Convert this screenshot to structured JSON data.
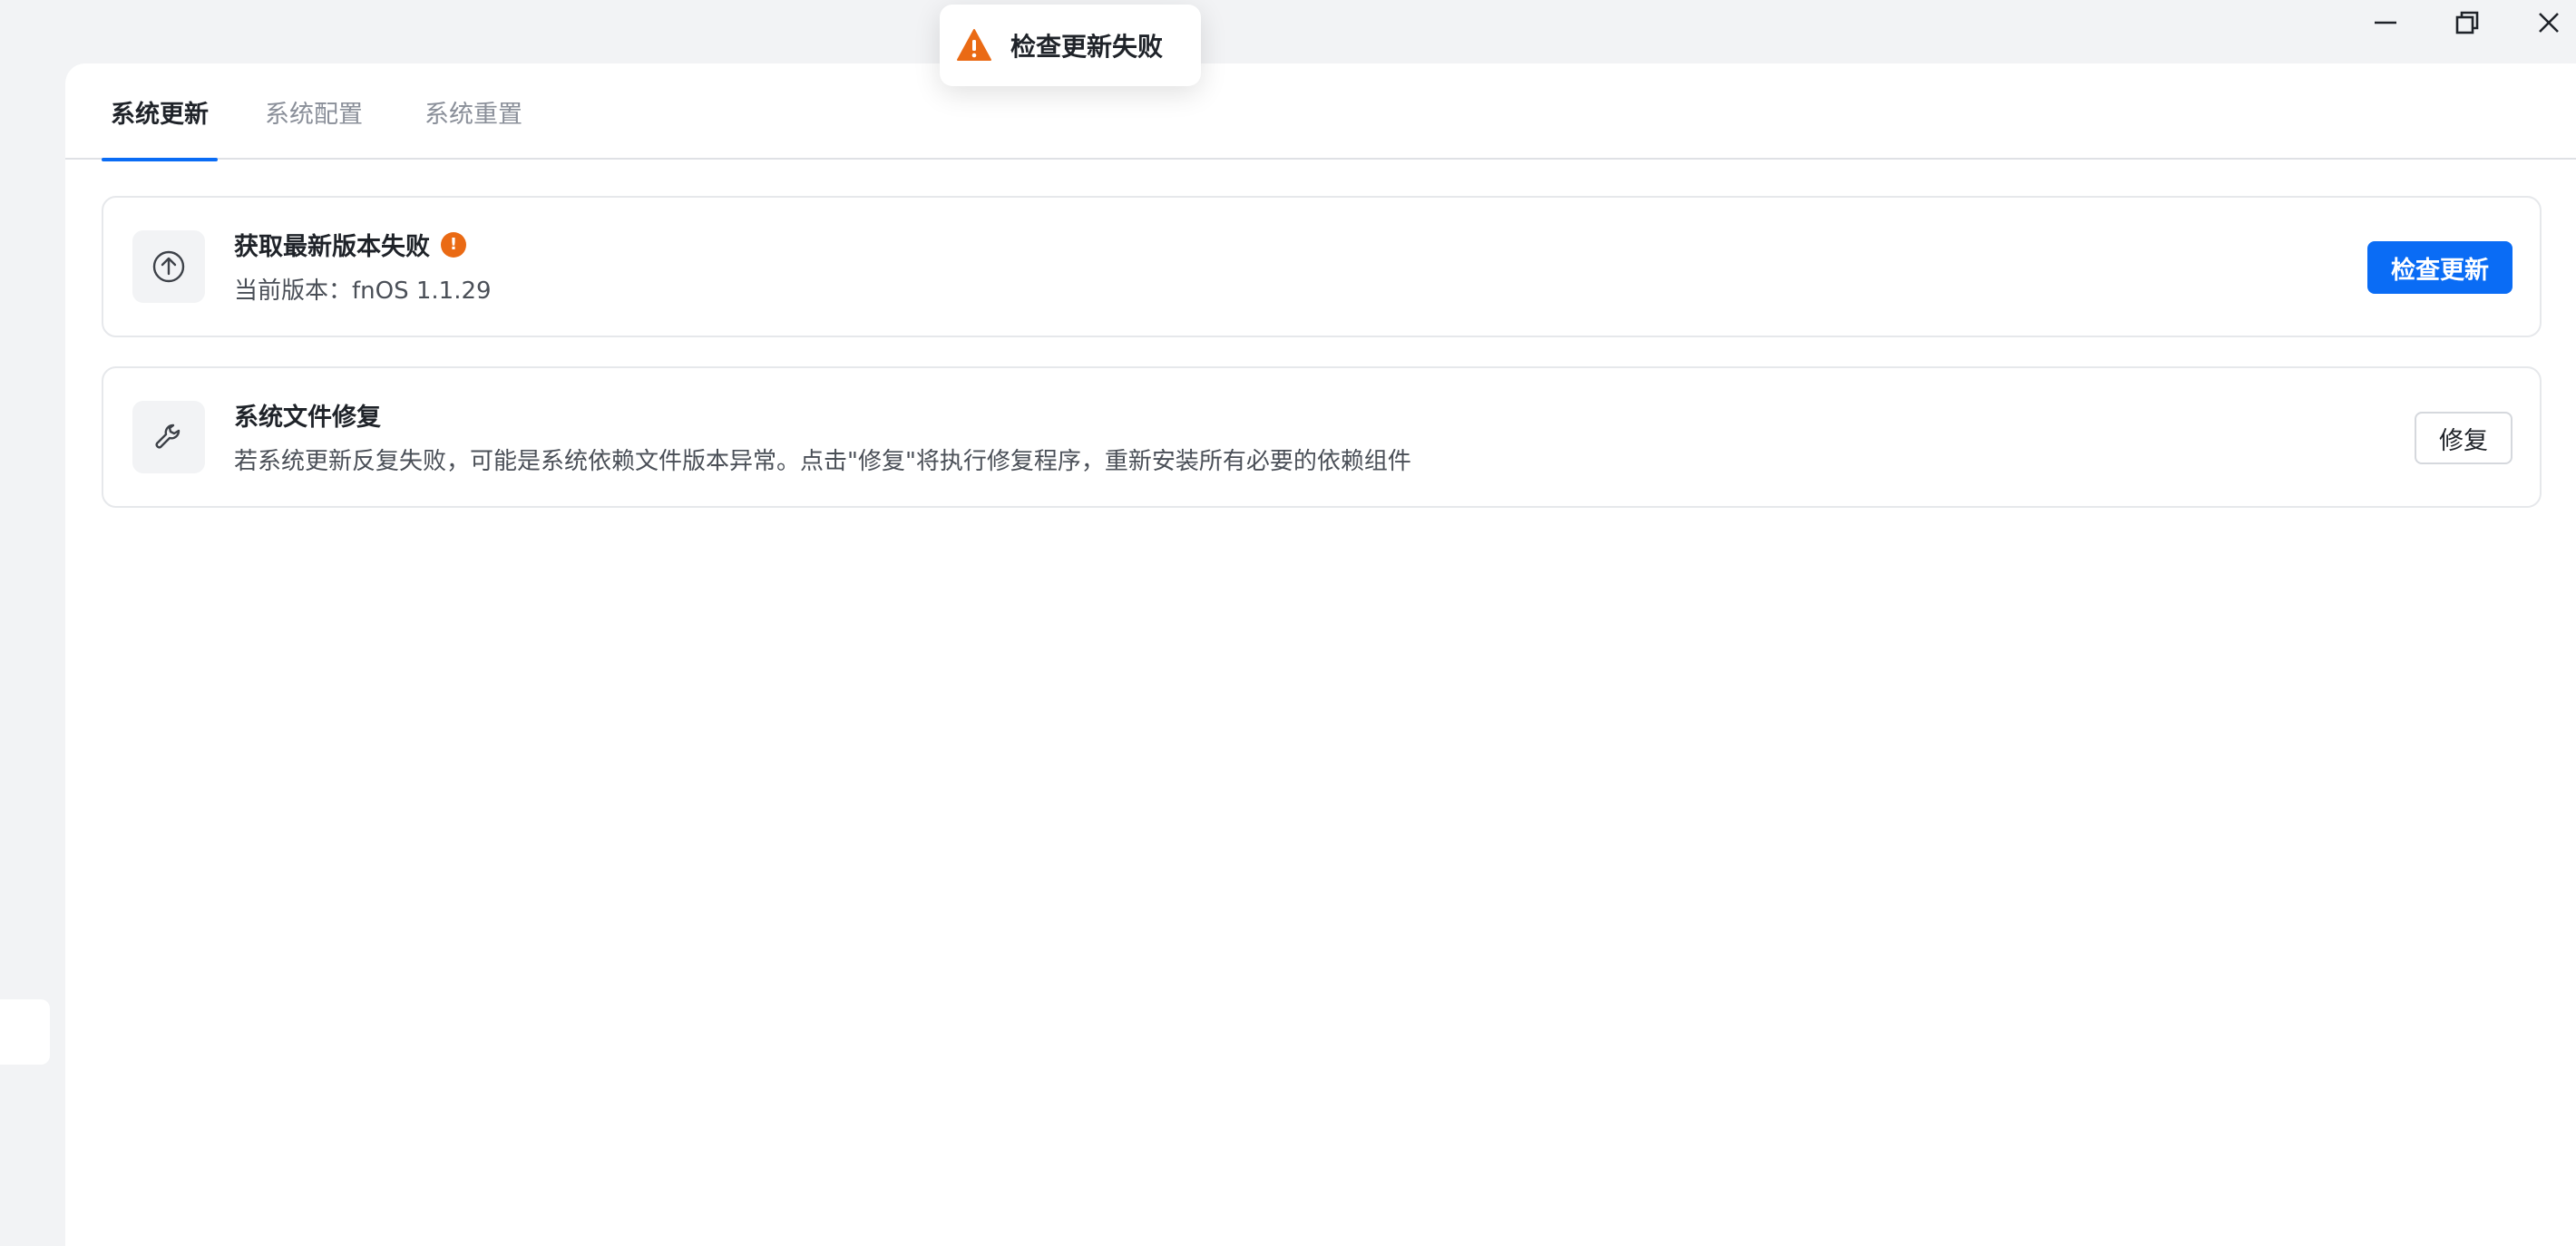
{
  "window_controls": {
    "minimize_icon": "minimize-icon",
    "maximize_icon": "restore-icon",
    "close_icon": "close-icon"
  },
  "tabs": [
    {
      "label": "系统更新",
      "active": true
    },
    {
      "label": "系统配置",
      "active": false
    },
    {
      "label": "系统重置",
      "active": false
    }
  ],
  "update_card": {
    "icon": "arrow-up-circle-icon",
    "title": "获取最新版本失败",
    "status_icon": "warning-dot-icon",
    "status_mark": "!",
    "description": "当前版本：fnOS 1.1.29",
    "button_label": "检查更新"
  },
  "repair_card": {
    "icon": "wrench-icon",
    "title": "系统文件修复",
    "description": "若系统更新反复失败，可能是系统依赖文件版本异常。点击\"修复\"将执行修复程序，重新安装所有必要的依赖组件",
    "button_label": "修复"
  },
  "toast": {
    "icon": "warning-triangle-icon",
    "message": "检查更新失败"
  },
  "colors": {
    "accent": "#0a6cf5",
    "warning": "#ea6a14",
    "background": "#f2f3f5"
  }
}
